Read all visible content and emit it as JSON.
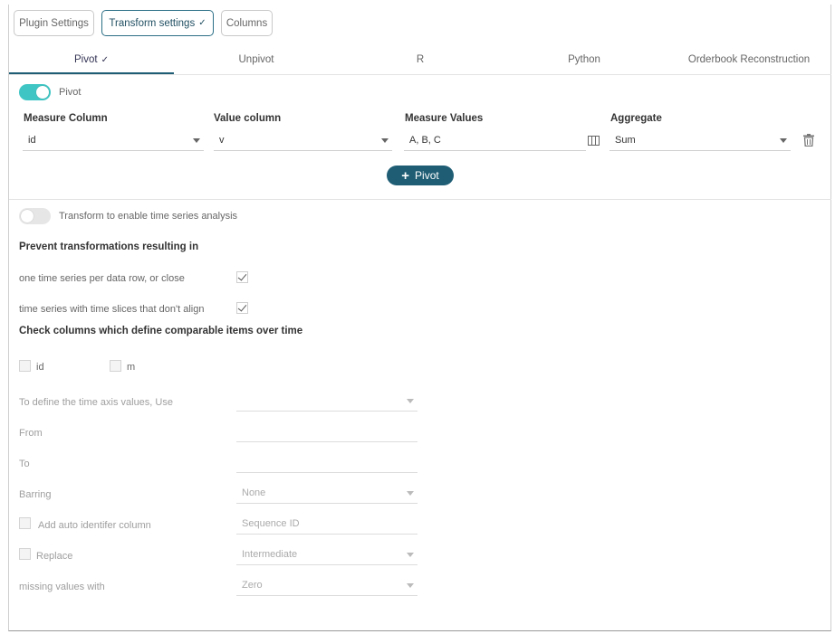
{
  "top_buttons": [
    {
      "label": "Plugin Settings"
    },
    {
      "label": "Transform settings",
      "check": "✓"
    },
    {
      "label": "Columns"
    }
  ],
  "tabs": [
    {
      "label": "Pivot",
      "check": "✓"
    },
    {
      "label": "Unpivot"
    },
    {
      "label": "R"
    },
    {
      "label": "Python"
    },
    {
      "label": "Orderbook Reconstruction"
    }
  ],
  "pivot": {
    "toggle_label": "Pivot",
    "toggle_on": true,
    "headers": {
      "measure_column": "Measure Column",
      "value_column": "Value column",
      "measure_values": "Measure Values",
      "aggregate": "Aggregate"
    },
    "row": {
      "measure_column": "id",
      "value_column": "v",
      "measure_values": "A, B, C",
      "aggregate": "Sum"
    },
    "add_button": "Pivot"
  },
  "timeseries": {
    "toggle_label": "Transform to enable time series analysis",
    "toggle_on": false,
    "prevent_heading": "Prevent transformations resulting in",
    "prevent_options": [
      {
        "label": "one time series per data row, or close",
        "checked": true
      },
      {
        "label": "time series with time slices that don't align",
        "checked": true
      }
    ],
    "comparable_heading": "Check columns which define comparable items over time",
    "columns": [
      {
        "label": "id",
        "checked": false
      },
      {
        "label": "m",
        "checked": false
      }
    ],
    "time_axis_label": "To define the time axis values, Use",
    "time_axis_value": "",
    "from_label": "From",
    "from_value": "",
    "to_label": "To",
    "to_value": "",
    "barring_label": "Barring",
    "barring_value": "None",
    "auto_id_label": "Add auto identifer column",
    "auto_id_placeholder": "Sequence ID",
    "replace_label": "Replace",
    "replace_value": "Intermediate",
    "missing_label": "missing values with",
    "missing_value": "Zero"
  },
  "colors": {
    "accent": "#1e5d74",
    "toggle_on": "#3fc6c4"
  },
  "icons": {
    "columns_picker": "columns-icon",
    "delete": "trash-icon",
    "dropdown": "chevron-down-icon"
  }
}
